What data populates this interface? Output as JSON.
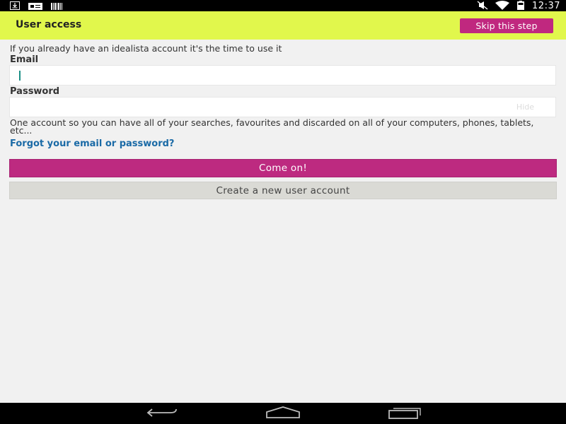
{
  "status_bar": {
    "time": "12:37",
    "left_icons": [
      "download-icon",
      "notification-card-icon",
      "barcode-icon"
    ],
    "right_icons": [
      "mute-icon",
      "wifi-icon",
      "battery-icon"
    ]
  },
  "header": {
    "title": "User access",
    "skip_label": "Skip this step",
    "background_color": "#e1f74c",
    "accent_color": "#c0287f"
  },
  "form": {
    "intro": "If you already have an idealista account it's the time to use it",
    "email_label": "Email",
    "email_value": "",
    "password_label": "Password",
    "password_value": "",
    "hide_label": "Hide",
    "help_text": "One account so you can have all of your searches, favourites and discarded on all of your computers, phones, tablets, etc...",
    "forgot_link": "Forgot your email or password?",
    "submit_label": "Come on!",
    "create_label": "Create a new user account"
  },
  "nav_bar": {
    "icons": [
      "back-icon",
      "home-icon",
      "recent-apps-icon"
    ]
  }
}
